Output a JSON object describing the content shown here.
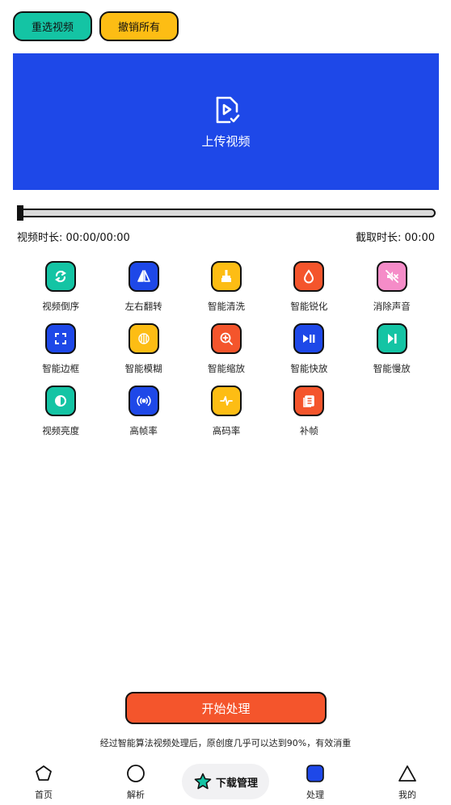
{
  "top_buttons": {
    "reselect": "重选视频",
    "undo_all": "撤销所有"
  },
  "upload": {
    "label": "上传视频",
    "bg_color": "#1e48e8"
  },
  "slider": {
    "position": 0
  },
  "time": {
    "video_duration": "视频时长: 00:00/00:00",
    "clip_duration": "截取时长: 00:00"
  },
  "tools": [
    {
      "label": "视频倒序",
      "color": "#14c4a4",
      "icon": "reverse-icon"
    },
    {
      "label": "左右翻转",
      "color": "#1e48e8",
      "icon": "flip-icon"
    },
    {
      "label": "智能清洗",
      "color": "#fdbd14",
      "icon": "broom-icon"
    },
    {
      "label": "智能锐化",
      "color": "#f4552c",
      "icon": "drop-icon"
    },
    {
      "label": "消除声音",
      "color": "#f58cc8",
      "icon": "mute-icon"
    },
    {
      "label": "智能边框",
      "color": "#1e48e8",
      "icon": "frame-icon"
    },
    {
      "label": "智能模糊",
      "color": "#fdbd14",
      "icon": "blur-icon"
    },
    {
      "label": "智能缩放",
      "color": "#f4552c",
      "icon": "zoom-icon"
    },
    {
      "label": "智能快放",
      "color": "#1e48e8",
      "icon": "fast-forward-icon"
    },
    {
      "label": "智能慢放",
      "color": "#14c4a4",
      "icon": "slow-play-icon"
    },
    {
      "label": "视频亮度",
      "color": "#14c4a4",
      "icon": "brightness-icon"
    },
    {
      "label": "高帧率",
      "color": "#1e48e8",
      "icon": "broadcast-icon"
    },
    {
      "label": "高码率",
      "color": "#fdbd14",
      "icon": "pulse-icon"
    },
    {
      "label": "补帧",
      "color": "#f4552c",
      "icon": "frames-icon"
    }
  ],
  "start_button": "开始处理",
  "note": "经过智能算法视频处理后，原创度几乎可以达到90%，有效消重",
  "tabbar": {
    "home": "首页",
    "parse": "解析",
    "download": "下载管理",
    "process": "处理",
    "mine": "我的"
  }
}
